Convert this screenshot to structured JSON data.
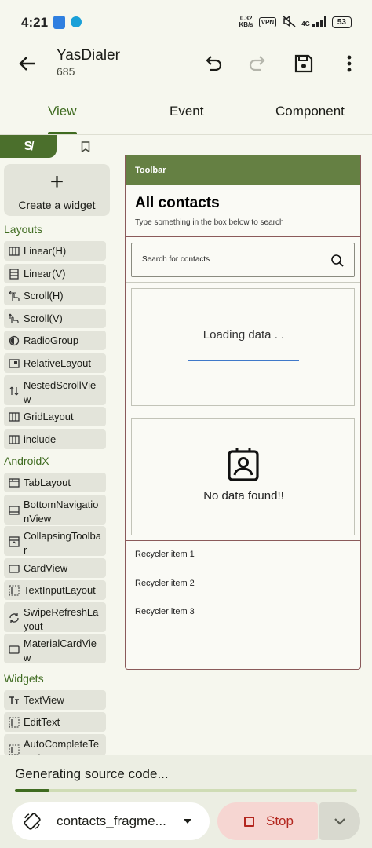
{
  "status_bar": {
    "time": "4:21",
    "net_speed_value": "0.32",
    "net_speed_unit": "KB/s",
    "vpn": "VPN",
    "network": "4G",
    "battery": "53"
  },
  "app_bar": {
    "title": "YasDialer",
    "subtitle": "685"
  },
  "tabs": [
    {
      "label": "View",
      "active": true
    },
    {
      "label": "Event",
      "active": false
    },
    {
      "label": "Component",
      "active": false
    }
  ],
  "palette": {
    "toggle_left_glyph": "S̸",
    "create_widget_label": "Create a widget",
    "sections": {
      "layouts": "Layouts",
      "androidx": "AndroidX",
      "widgets": "Widgets"
    },
    "layouts": [
      {
        "label": "Linear(H)",
        "icon": "linear-horizontal-icon"
      },
      {
        "label": "Linear(V)",
        "icon": "linear-vertical-icon"
      },
      {
        "label": "Scroll(H)",
        "icon": "scroll-horizontal-icon"
      },
      {
        "label": "Scroll(V)",
        "icon": "scroll-vertical-icon"
      },
      {
        "label": "RadioGroup",
        "icon": "radio-group-icon"
      },
      {
        "label": "RelativeLayout",
        "icon": "relative-layout-icon"
      },
      {
        "label": "NestedScrollView",
        "icon": "nested-scroll-icon"
      },
      {
        "label": "GridLayout",
        "icon": "grid-layout-icon"
      },
      {
        "label": "include",
        "icon": "include-icon"
      }
    ],
    "androidx": [
      {
        "label": "TabLayout",
        "icon": "tab-layout-icon"
      },
      {
        "label": "BottomNavigationView",
        "icon": "bottom-navigation-icon"
      },
      {
        "label": "CollapsingToolbar",
        "icon": "collapsing-toolbar-icon"
      },
      {
        "label": "CardView",
        "icon": "card-view-icon"
      },
      {
        "label": "TextInputLayout",
        "icon": "text-input-layout-icon"
      },
      {
        "label": "SwipeRefreshLayout",
        "icon": "swipe-refresh-icon"
      },
      {
        "label": "MaterialCardView",
        "icon": "material-card-icon"
      }
    ],
    "widgets": [
      {
        "label": "TextView",
        "icon": "text-view-icon"
      },
      {
        "label": "EditText",
        "icon": "edit-text-icon"
      },
      {
        "label": "AutoCompleteTextView",
        "icon": "autocomplete-icon"
      }
    ]
  },
  "preview": {
    "toolbar": "Toolbar",
    "title": "All contacts",
    "subtitle": "Type something in the box below to search",
    "search_placeholder": "Search for contacts",
    "loading_text": "Loading data . .",
    "empty_text": "No data found!!",
    "recycler_items": [
      "Recycler item 1",
      "Recycler item 2",
      "Recycler item 3"
    ]
  },
  "generating": {
    "text": "Generating source code...",
    "progress": 0.1
  },
  "bottom_bar": {
    "file_name": "contacts_fragme...",
    "stop_label": "Stop"
  },
  "colors": {
    "accent": "#3f6b20",
    "toolbar": "#658043",
    "stop": "#b3261e"
  }
}
